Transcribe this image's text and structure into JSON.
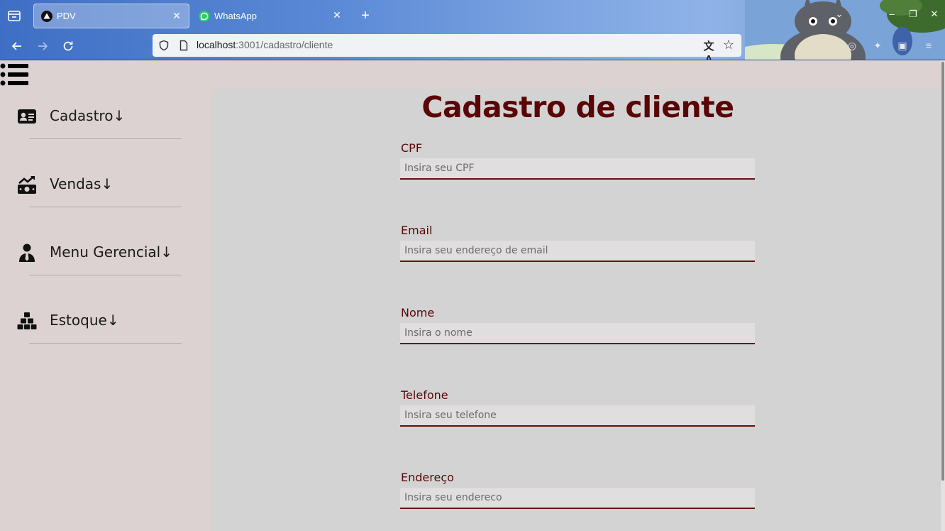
{
  "browser": {
    "tabs": [
      {
        "title": "PDV",
        "active": true
      },
      {
        "title": "WhatsApp",
        "active": false
      }
    ],
    "url_host": "localhost",
    "url_path": ":3001/cadastro/cliente",
    "colors": {
      "whatsapp": "#25d366",
      "chrome_accent": "#5a89d6"
    }
  },
  "sidebar": {
    "items": [
      {
        "label": "Cadastro",
        "arrow": "↓",
        "icon": "id-card-icon"
      },
      {
        "label": "Vendas",
        "arrow": "↓",
        "icon": "money-chart-icon"
      },
      {
        "label": "Menu Gerencial",
        "arrow": "↓",
        "icon": "manager-icon"
      },
      {
        "label": "Estoque",
        "arrow": "↓",
        "icon": "boxes-icon"
      }
    ]
  },
  "form": {
    "title": "Cadastro de cliente",
    "fields": [
      {
        "label": "CPF",
        "placeholder": "Insira seu CPF"
      },
      {
        "label": "Email",
        "placeholder": "Insira seu endereço de email"
      },
      {
        "label": "Nome",
        "placeholder": "Insira o nome"
      },
      {
        "label": "Telefone",
        "placeholder": "Insira seu telefone"
      },
      {
        "label": "Endereço",
        "placeholder": "Insira seu endereco"
      }
    ]
  },
  "theme": {
    "title_color": "#5a0606",
    "sidebar_bg": "#dcd2d2",
    "main_bg": "#d3d3d3"
  }
}
